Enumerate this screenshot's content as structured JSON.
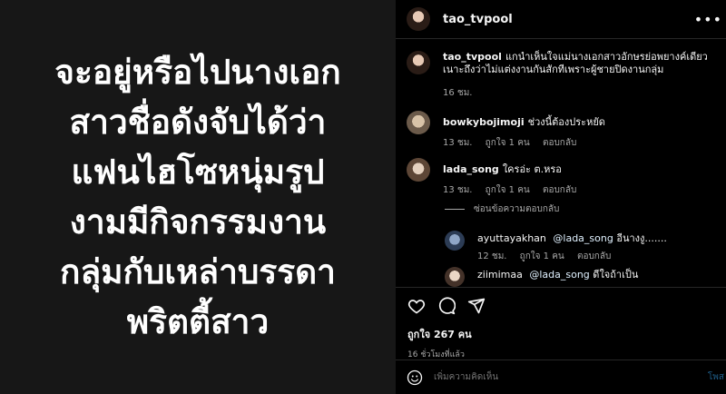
{
  "headline": "จะอยู่หรือไปนางเอก\nสาวชื่อดังจับได้ว่า\nแฟนไฮโซหนุ่มรูป\nงามมีกิจกรรมงาน\nกลุ่มกับเหล่าบรรดา\nพริตตี้สาว",
  "header": {
    "username": "tao_tvpool",
    "more_icon": "more-icon"
  },
  "caption": {
    "username": "tao_tvpool",
    "text": "แกนำเห็นใจแม่นางเอกสาวอักษรย่อพยางค์เดียวเนาะถึงว่าไม่แต่งงานกันสักทีเพราะผู้ชายปิดงานกลุ่ม",
    "time": "16 ชม."
  },
  "comments": [
    {
      "username": "bowkybojimoji",
      "text": "ช่วงนี้ต้องประหยัด",
      "time": "13 ชม.",
      "likes": "ถูกใจ 1 คน",
      "reply": "ตอบกลับ"
    },
    {
      "username": "lada_song",
      "text": "ใครอ่ะ ต.หรอ",
      "time": "13 ชม.",
      "likes": "ถูกใจ 1 คน",
      "reply": "ตอบกลับ"
    }
  ],
  "reply_toggle": "ซ่อนข้อความตอบกลับ",
  "replies": [
    {
      "username": "ayuttayakhan",
      "mention": "@lada_song",
      "text": "อีนางงู.......",
      "time": "12 ชม.",
      "likes": "ถูกใจ 1 คน",
      "reply": "ตอบกลับ"
    },
    {
      "username": "ziimimaa",
      "mention": "@lada_song",
      "text": "ดีใจถ้าเป็น"
    }
  ],
  "actions": {
    "like_icon": "heart-icon",
    "comment_icon": "comment-icon",
    "share_icon": "share-icon",
    "likes_text": "ถูกใจ 267 คน",
    "time_ago": "16 ชั่วโมงที่แล้ว"
  },
  "comment_input": {
    "placeholder": "เพิ่มความคิดเห็น",
    "post_label": "โพส"
  }
}
